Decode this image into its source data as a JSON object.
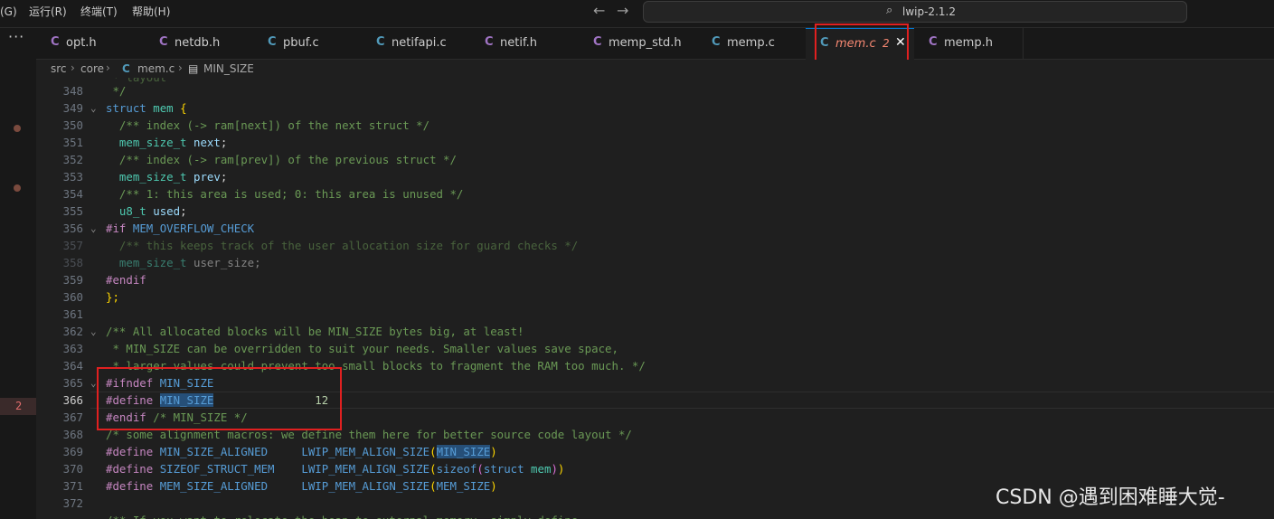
{
  "menu": [
    "(G)",
    "运行(R)",
    "终端(T)",
    "帮助(H)"
  ],
  "nav": {
    "back": "←",
    "forward": "→"
  },
  "search": {
    "icon": "search-icon",
    "text": "lwip-2.1.2"
  },
  "activity": {
    "more": "···",
    "problem_count": "2"
  },
  "tabs": [
    {
      "label": "opt.h",
      "icon": "C",
      "icon_color": "#a074c4"
    },
    {
      "label": "netdb.h",
      "icon": "C",
      "icon_color": "#a074c4"
    },
    {
      "label": "pbuf.c",
      "icon": "C",
      "icon_color": "#519aba"
    },
    {
      "label": "netifapi.c",
      "icon": "C",
      "icon_color": "#519aba"
    },
    {
      "label": "netif.h",
      "icon": "C",
      "icon_color": "#a074c4"
    },
    {
      "label": "memp_std.h",
      "icon": "C",
      "icon_color": "#a074c4"
    },
    {
      "label": "memp.c",
      "icon": "C",
      "icon_color": "#519aba"
    },
    {
      "label": "mem.c",
      "icon": "C",
      "icon_color": "#519aba",
      "problems": "2",
      "close": "✕",
      "active": true
    },
    {
      "label": "memp.h",
      "icon": "C",
      "icon_color": "#a074c4"
    }
  ],
  "breadcrumb": {
    "seg1": "src",
    "seg2": "core",
    "icon": "C",
    "seg3": "mem.c",
    "seg4": "MIN_SIZE",
    "sep": "›"
  },
  "code": {
    "line_numbers": [
      "348",
      "349",
      "350",
      "351",
      "352",
      "353",
      "354",
      "355",
      "356",
      "357",
      "358",
      "359",
      "360",
      "361",
      "362",
      "363",
      "364",
      "365",
      "366",
      "367",
      "368",
      "369",
      "370",
      "371",
      "372"
    ],
    "fold_marker": "⌄",
    "top_partial": " * layout",
    "l348": " */",
    "l349_kw": "struct",
    "l349_name": "mem",
    "l349_brace": "{",
    "l350": "  /** index (-> ram[next]) of the next struct */",
    "l351_type": "  mem_size_t",
    "l351_id": "next",
    "l352": "  /** index (-> ram[prev]) of the previous struct */",
    "l353_type": "  mem_size_t",
    "l353_id": "prev",
    "l354": "  /** 1: this area is used; 0: this area is unused */",
    "l355_type": "  u8_t",
    "l355_id": "used",
    "l356_pp": "#if",
    "l356_macro": "MEM_OVERFLOW_CHECK",
    "l357": "  /** this keeps track of the user allocation size for guard checks */",
    "l358_type": "  mem_size_t",
    "l358_id": "user_size;",
    "l359": "#endif",
    "l360": "};",
    "l362": "/** All allocated blocks will be MIN_SIZE bytes big, at least!",
    "l363": " * MIN_SIZE can be overridden to suit your needs. Smaller values save space,",
    "l364": " * larger values could prevent too small blocks to fragment the RAM too much. */",
    "l365_pp": "#ifndef",
    "l365_macro": "MIN_SIZE",
    "l366_pp": "#define",
    "l366_macro": "MIN_SIZE",
    "l366_value": "12",
    "l367_pp": "#endif",
    "l367_cm": "/* MIN_SIZE */",
    "l368": "/* some alignment macros: we define them here for better source code layout */",
    "define": "#define",
    "l369_name": "MIN_SIZE_ALIGNED",
    "l370_name": "SIZEOF_STRUCT_MEM",
    "l371_name": "MEM_SIZE_ALIGNED",
    "align_fn": "LWIP_MEM_ALIGN_SIZE",
    "l369_arg": "MIN_SIZE",
    "l370_sizeof": "sizeof",
    "l370_struct": "struct",
    "l370_mem": "mem",
    "l371_arg": "MEM_SIZE",
    "l373": "/** If you want to relocate the heap to external memory, simply define"
  },
  "watermark": "CSDN @遇到困难睡大觉-"
}
